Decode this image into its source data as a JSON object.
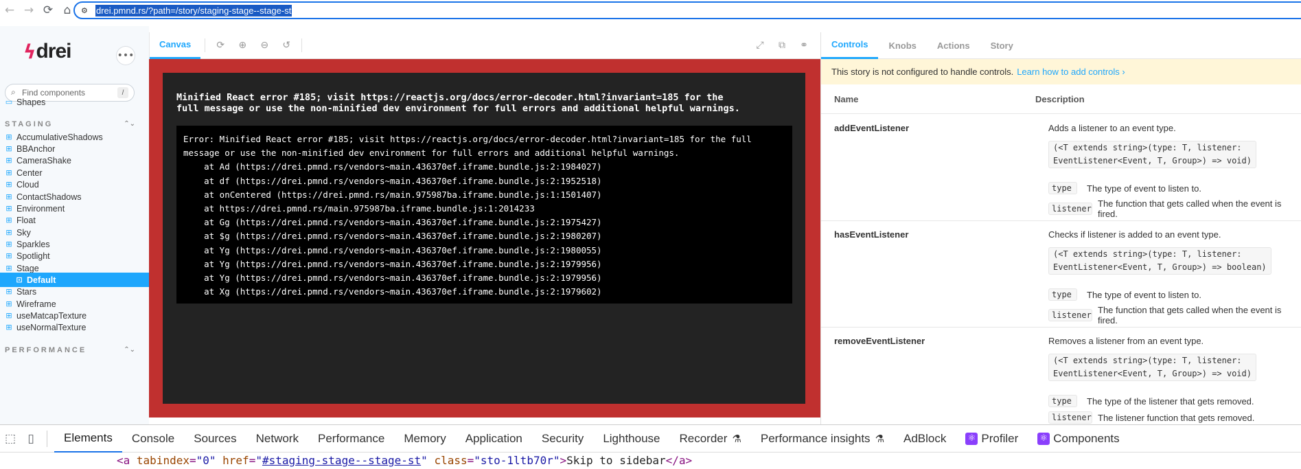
{
  "browser": {
    "url": "drei.pmnd.rs/?path=/story/staging-stage--stage-st",
    "back_icon": "arrow-left",
    "forward_icon": "arrow-right",
    "reload_icon": "reload",
    "home_icon": "home"
  },
  "sidebar": {
    "logo_text": "drei",
    "search_placeholder": "Find components",
    "search_shortcut": "/",
    "shapes_label": "Shapes",
    "staging_header": "STAGING",
    "performance_header": "PERFORMANCE",
    "items": [
      {
        "label": "AccumulativeShadows"
      },
      {
        "label": "BBAnchor"
      },
      {
        "label": "CameraShake"
      },
      {
        "label": "Center"
      },
      {
        "label": "Cloud"
      },
      {
        "label": "ContactShadows"
      },
      {
        "label": "Environment"
      },
      {
        "label": "Float"
      },
      {
        "label": "Sky"
      },
      {
        "label": "Sparkles"
      },
      {
        "label": "Spotlight"
      },
      {
        "label": "Stage"
      },
      {
        "label": "Default"
      },
      {
        "label": "Stars"
      },
      {
        "label": "Wireframe"
      },
      {
        "label": "useMatcapTexture"
      },
      {
        "label": "useNormalTexture"
      }
    ]
  },
  "canvas": {
    "tab_label": "Canvas",
    "error_message": "Minified React error #185; visit https://reactjs.org/docs/error-decoder.html?invariant=185 for the\nfull message or use the non-minified dev environment for full errors and additional helpful warnings.",
    "stack_trace": "Error: Minified React error #185; visit https://reactjs.org/docs/error-decoder.html?invariant=185 for the full\nmessage or use the non-minified dev environment for full errors and additional helpful warnings.\n    at Ad (https://drei.pmnd.rs/vendors~main.436370ef.iframe.bundle.js:2:1984027)\n    at df (https://drei.pmnd.rs/vendors~main.436370ef.iframe.bundle.js:2:1952518)\n    at onCentered (https://drei.pmnd.rs/main.975987ba.iframe.bundle.js:1:1501407)\n    at https://drei.pmnd.rs/main.975987ba.iframe.bundle.js:1:2014233\n    at Gg (https://drei.pmnd.rs/vendors~main.436370ef.iframe.bundle.js:2:1975427)\n    at $g (https://drei.pmnd.rs/vendors~main.436370ef.iframe.bundle.js:2:1980207)\n    at Yg (https://drei.pmnd.rs/vendors~main.436370ef.iframe.bundle.js:2:1980055)\n    at Yg (https://drei.pmnd.rs/vendors~main.436370ef.iframe.bundle.js:2:1979956)\n    at Yg (https://drei.pmnd.rs/vendors~main.436370ef.iframe.bundle.js:2:1979956)\n    at Xg (https://drei.pmnd.rs/vendors~main.436370ef.iframe.bundle.js:2:1979602)"
  },
  "panel": {
    "tabs": [
      {
        "label": "Controls"
      },
      {
        "label": "Knobs"
      },
      {
        "label": "Actions"
      },
      {
        "label": "Story"
      }
    ],
    "notice_text": "This story is not configured to handle controls.",
    "notice_link": "Learn how to add controls ›",
    "col_name": "Name",
    "col_description": "Description",
    "rows": [
      {
        "name": "addEventListener",
        "description": "Adds a listener to an event type.",
        "signature": "(<T extends string>(type: T, listener:\nEventListener<Event, T, Group>) => void)",
        "params": [
          {
            "name": "type",
            "desc": "The type of event to listen to."
          },
          {
            "name": "listener",
            "desc": "The function that gets called when the event is fired."
          }
        ]
      },
      {
        "name": "hasEventListener",
        "description": "Checks if listener is added to an event type.",
        "signature": "(<T extends string>(type: T, listener:\nEventListener<Event, T, Group>) => boolean)",
        "params": [
          {
            "name": "type",
            "desc": "The type of event to listen to."
          },
          {
            "name": "listener",
            "desc": "The function that gets called when the event is fired."
          }
        ]
      },
      {
        "name": "removeEventListener",
        "description": "Removes a listener from an event type.",
        "signature": "(<T extends string>(type: T, listener:\nEventListener<Event, T, Group>) => void)",
        "params": [
          {
            "name": "type",
            "desc": "The type of the listener that gets removed."
          },
          {
            "name": "listener",
            "desc": "The listener function that gets removed."
          }
        ]
      }
    ]
  },
  "devtools": {
    "tabs": [
      {
        "label": "Elements"
      },
      {
        "label": "Console"
      },
      {
        "label": "Sources"
      },
      {
        "label": "Network"
      },
      {
        "label": "Performance"
      },
      {
        "label": "Memory"
      },
      {
        "label": "Application"
      },
      {
        "label": "Security"
      },
      {
        "label": "Lighthouse"
      },
      {
        "label": "Recorder"
      },
      {
        "label": "Performance insights"
      },
      {
        "label": "AdBlock"
      },
      {
        "label": "Profiler"
      },
      {
        "label": "Components"
      }
    ],
    "code_tag_open": "<a ",
    "code_attr1": "tabindex",
    "code_val1": "\"0\"",
    "code_attr2": "href",
    "code_val2": "#staging-stage--stage-st",
    "code_attr3": "class",
    "code_val3": "\"sto-1ltb70r\"",
    "code_text": "Skip to sidebar",
    "code_tag_close": "</a>"
  },
  "colors": {
    "accent": "#1ea7fd",
    "error_bg": "#c0302f",
    "notice_bg": "#fff6d8",
    "chrome_focus": "#1a73e8"
  }
}
